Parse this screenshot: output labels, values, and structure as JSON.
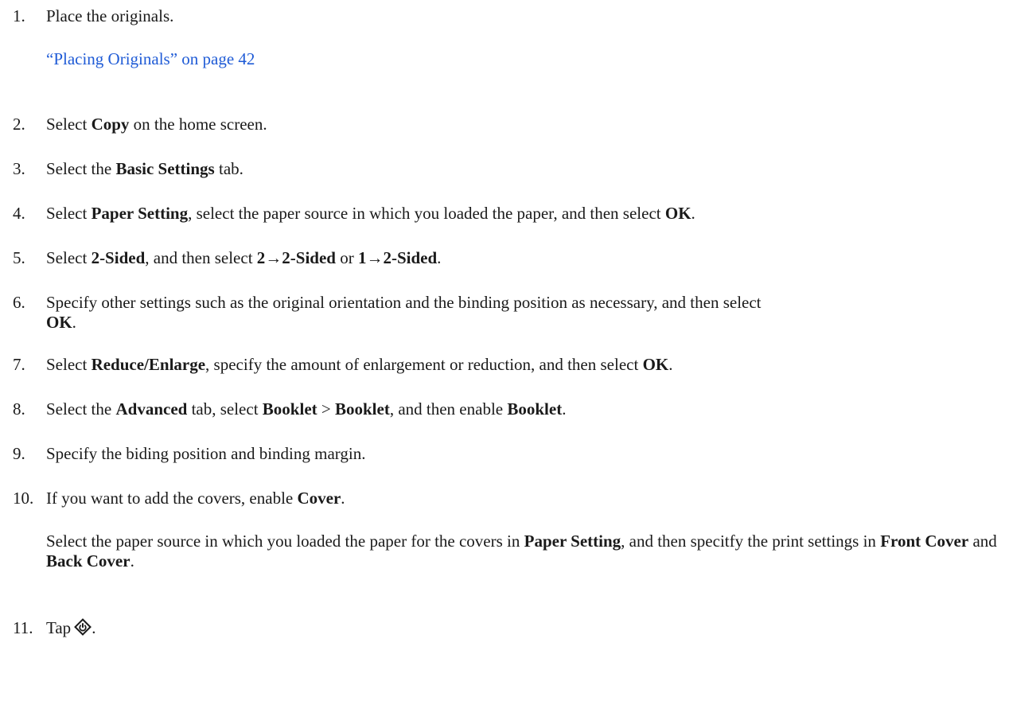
{
  "steps": [
    {
      "num": "1.",
      "text": "Place the originals."
    },
    {
      "num": "2.",
      "pre": "Select ",
      "b1": "Copy",
      "post": " on the home screen."
    },
    {
      "num": "3.",
      "pre": "Select the ",
      "b1": "Basic Settings",
      "post": " tab."
    },
    {
      "num": "4.",
      "pre": "Select ",
      "b1": "Paper Setting",
      "mid": ", select the paper source in which you loaded the paper, and then select ",
      "b2": "OK",
      "post": "."
    },
    {
      "num": "5.",
      "pre": "Select ",
      "b1": "2-Sided",
      "mid1": ", and then select ",
      "b2": "2→2-Sided",
      "mid2": " or ",
      "b3": "1→2-Sided",
      "post": "."
    },
    {
      "num": "6.",
      "text": "Specify other settings such as the original orientation and the binding position as necessary, and then select",
      "b1": "OK",
      "post": "."
    },
    {
      "num": "7.",
      "pre": "Select ",
      "b1": "Reduce/Enlarge",
      "mid": ", specify the amount of enlargement or reduction, and then select ",
      "b2": "OK",
      "post": "."
    },
    {
      "num": "8.",
      "pre": "Select the ",
      "b1": "Advanced",
      "mid1": " tab, select ",
      "b2": "Booklet",
      "mid2": " > ",
      "b3": "Booklet",
      "mid3": ", and then enable ",
      "b4": "Booklet",
      "post": "."
    },
    {
      "num": "9.",
      "text": "Specify the biding position and binding margin."
    },
    {
      "num": "10.",
      "pre": "If you want to add the covers, enable ",
      "b1": "Cover",
      "post": "."
    },
    {
      "num": "11.",
      "pre": "Tap",
      "post": "."
    }
  ],
  "link": {
    "text": "“Placing Originals” on page 42"
  },
  "step10_note": {
    "pre": "Select the paper source in which you loaded the paper for the covers in ",
    "b1": "Paper Setting",
    "mid": ", and then specitfy the print settings in ",
    "b2": "Front Cover",
    "mid2": " and ",
    "b3": "Back Cover",
    "post": "."
  },
  "icons": {
    "start": "start-icon"
  },
  "colors": {
    "link": "#1f5bd6",
    "text": "#1a1a1a"
  }
}
